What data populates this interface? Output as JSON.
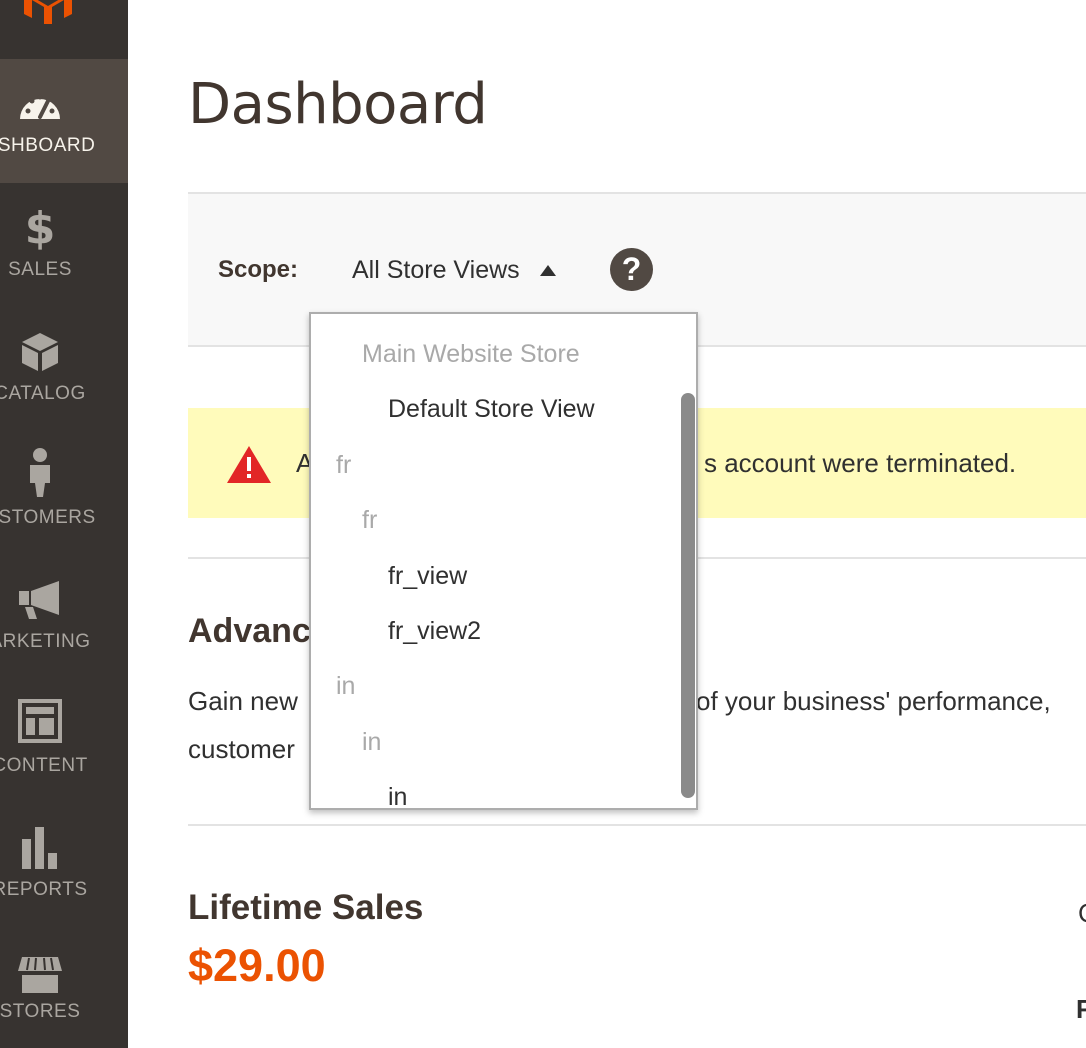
{
  "sidebar": {
    "items": [
      {
        "label": "ASHBOARD",
        "icon": "dashboard-gauge-icon",
        "active": true
      },
      {
        "label": "SALES",
        "icon": "dollar-icon"
      },
      {
        "label": "CATALOG",
        "icon": "box-icon"
      },
      {
        "label": "USTOMERS",
        "icon": "person-icon"
      },
      {
        "label": "ARKETING",
        "icon": "megaphone-icon"
      },
      {
        "label": "CONTENT",
        "icon": "layout-icon"
      },
      {
        "label": "REPORTS",
        "icon": "bar-chart-icon"
      },
      {
        "label": "STORES",
        "icon": "storefront-icon"
      }
    ]
  },
  "colors": {
    "sidebar_bg": "#373330",
    "sidebar_active": "#514943",
    "logo": "#eb5202",
    "accent_value": "#eb5202",
    "notice_bg": "#fffbbb",
    "warning_icon": "#e22626"
  },
  "page": {
    "title": "Dashboard"
  },
  "scope": {
    "label": "Scope:",
    "selected": "All Store Views",
    "help_glyph": "?"
  },
  "dropdown": {
    "items": [
      {
        "label": "Main Website Store",
        "kind": "group"
      },
      {
        "label": "Default Store View",
        "kind": "view"
      },
      {
        "label": "fr",
        "kind": "group"
      },
      {
        "label": "fr",
        "kind": "group"
      },
      {
        "label": "fr_view",
        "kind": "view"
      },
      {
        "label": "fr_view2",
        "kind": "view"
      },
      {
        "label": "in",
        "kind": "group"
      },
      {
        "label": "in",
        "kind": "group"
      },
      {
        "label": "in",
        "kind": "view"
      }
    ]
  },
  "notice": {
    "text_start": "A",
    "text_end": "s account were terminated."
  },
  "advanced": {
    "title": "Advanc",
    "text_a": "Gain new",
    "text_b": "of your business' performance,",
    "text_c": "customer"
  },
  "lifetime_sales": {
    "title": "Lifetime Sales",
    "value": "$29.00"
  },
  "edge_text": {
    "a": "C",
    "b": "F"
  }
}
